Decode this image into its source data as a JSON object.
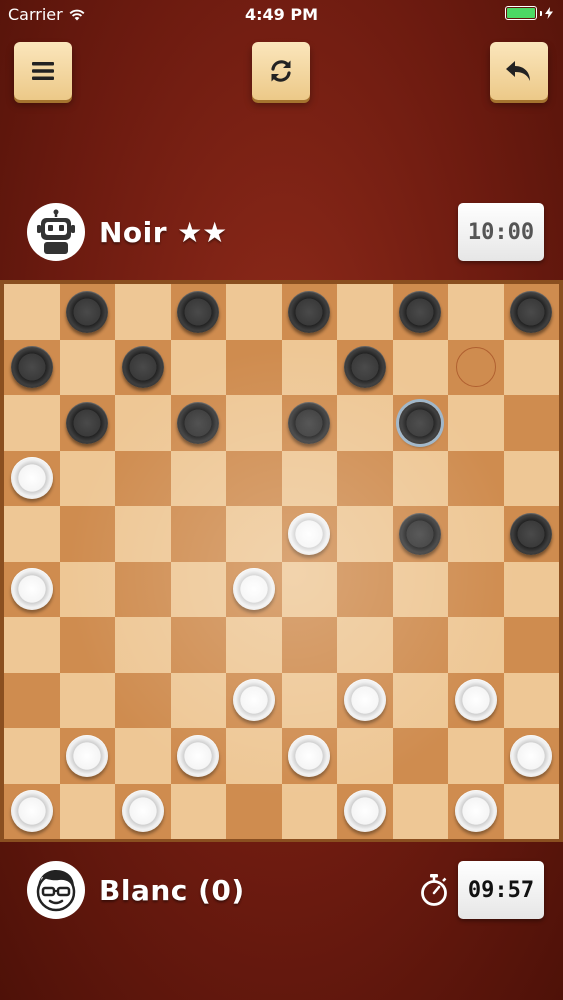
{
  "status_bar": {
    "carrier": "Carrier",
    "time": "4:49 PM",
    "battery_color": "#4cd964"
  },
  "toolbar": {
    "menu_icon": "hamburger-menu-icon",
    "restart_icon": "refresh-icon",
    "undo_icon": "undo-arrow-icon"
  },
  "opponent": {
    "name": "Noir",
    "stars": "★★",
    "avatar_icon": "robot-icon",
    "clock": "10:00"
  },
  "player": {
    "name": "Blanc (0)",
    "avatar_icon": "boy-with-glasses-icon",
    "timer_icon": "stopwatch-icon",
    "clock": "09:57"
  },
  "board": {
    "size": 10,
    "colors": {
      "light": "#eec795",
      "dark": "#cf8c4f",
      "frame": "#8a4f20"
    },
    "pieces": {
      "black": [
        [
          0,
          1
        ],
        [
          0,
          3
        ],
        [
          0,
          5
        ],
        [
          0,
          7
        ],
        [
          0,
          9
        ],
        [
          1,
          0
        ],
        [
          1,
          2
        ],
        [
          1,
          6
        ],
        [
          2,
          1
        ],
        [
          2,
          3
        ],
        [
          2,
          5
        ],
        [
          2,
          7
        ],
        [
          4,
          7
        ],
        [
          4,
          9
        ]
      ],
      "white": [
        [
          3,
          0
        ],
        [
          4,
          5
        ],
        [
          5,
          0
        ],
        [
          5,
          4
        ],
        [
          7,
          4
        ],
        [
          7,
          6
        ],
        [
          7,
          8
        ],
        [
          8,
          1
        ],
        [
          8,
          3
        ],
        [
          8,
          5
        ],
        [
          8,
          9
        ],
        [
          9,
          0
        ],
        [
          9,
          2
        ],
        [
          9,
          6
        ],
        [
          9,
          8
        ]
      ]
    },
    "selected": [
      2,
      7
    ],
    "move_targets": [
      [
        1,
        8
      ]
    ]
  }
}
